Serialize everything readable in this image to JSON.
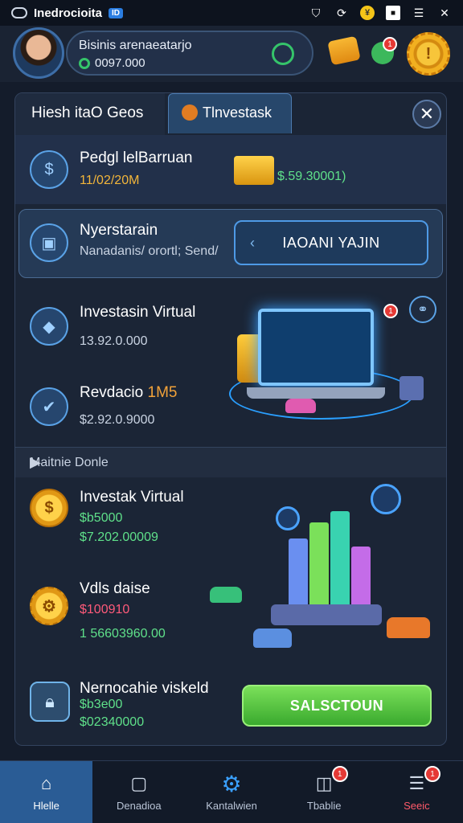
{
  "status_bar": {
    "app_name": "Inedrocioita",
    "badge": "ID"
  },
  "profile": {
    "name": "Bisinis arenaeatarjo",
    "balance": "0097.000"
  },
  "tabs": [
    {
      "label": "Hiesh itaO Geos"
    },
    {
      "label": "Tlnvestask"
    }
  ],
  "rows": {
    "r1": {
      "title": "Pedgl lelBarruan",
      "sub": "11/02/20M",
      "amount": "$.59.30001)"
    },
    "r2": {
      "title": "Nyerstarain",
      "sub": "Nanadanis/ orortl; Send/",
      "button": "IAOANI YAJIN"
    },
    "r3": {
      "title": "Investasin Virtual",
      "sub": "13.92.0.000"
    },
    "r4": {
      "title": "Revdacio",
      "title_accent": "1M5",
      "sub": "$2.92.0.9000"
    }
  },
  "section": {
    "title": "Maitnie Donle"
  },
  "cards": {
    "c1": {
      "title": "Investak Virtual",
      "line1": "$b5000",
      "line2": "$7.202.00009"
    },
    "c2": {
      "title": "Vdls daise",
      "line1": "$100910",
      "line2": "1 56603960.00"
    },
    "c3": {
      "title": "Nernocahie viskeld",
      "line1": "$b3e00",
      "line2": "$02340000",
      "button": "SALSCTOUN"
    }
  },
  "notifications": {
    "header_leaf": "1",
    "laptop": "1",
    "nav_4": "1",
    "nav_5": "1"
  },
  "bottom_nav": [
    {
      "label": "Hlelle",
      "icon": "home-icon",
      "active": true
    },
    {
      "label": "Denadioa",
      "icon": "document-icon"
    },
    {
      "label": "Kantalwien",
      "icon": "gear-icon"
    },
    {
      "label": "Tbablie",
      "icon": "stack-icon"
    },
    {
      "label": "Seeic",
      "icon": "list-icon"
    }
  ]
}
